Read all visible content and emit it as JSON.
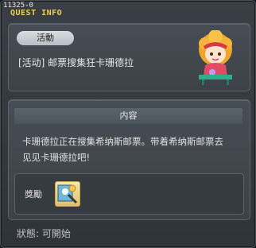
{
  "window": {
    "quest_id": "11325-0",
    "title": "QUEST INFO"
  },
  "event_panel": {
    "tag": "活動",
    "name": "[活动] 邮票搜集狂卡珊德拉"
  },
  "content_panel": {
    "header": "内容",
    "description_lines": [
      "卡珊德拉正在搜集希纳斯邮票。带着希纳斯邮票去",
      "见见卡珊德拉吧!"
    ],
    "reward_label": "獎勵"
  },
  "status": {
    "text": "狀態:  可開始"
  }
}
